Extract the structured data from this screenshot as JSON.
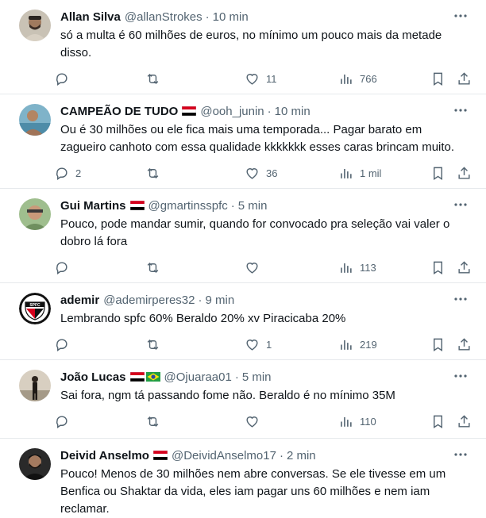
{
  "tweets": [
    {
      "name": "Allan Silva",
      "flags": [],
      "handle": "@allanStrokes",
      "time": "10 min",
      "text": "só a multa é 60 milhões de euros, no mínimo um pouco mais da metade\ndisso.",
      "replies": "",
      "retweets": "",
      "likes": "11",
      "views": "766"
    },
    {
      "name": "CAMPEÃO DE TUDO",
      "flags": [
        "spfc"
      ],
      "handle": "@ooh_junin",
      "time": "10 min",
      "text": "Ou é 30 milhões ou ele fica mais uma temporada... Pagar barato em\nzagueiro canhoto com essa qualidade kkkkkkk esses caras brincam muito.",
      "replies": "2",
      "retweets": "",
      "likes": "36",
      "views": "1 mil"
    },
    {
      "name": "Gui Martins",
      "flags": [
        "spfc"
      ],
      "handle": "@gmartinsspfc",
      "time": "5 min",
      "text": "Pouco, pode mandar sumir, quando for convocado pra seleção vai valer o\ndobro lá fora",
      "replies": "",
      "retweets": "",
      "likes": "",
      "views": "113"
    },
    {
      "name": "ademir",
      "flags": [],
      "handle": "@ademirperes32",
      "time": "9 min",
      "text": "Lembrando spfc 60% Beraldo 20% xv Piracicaba 20%",
      "replies": "",
      "retweets": "",
      "likes": "1",
      "views": "219"
    },
    {
      "name": "João Lucas",
      "flags": [
        "spfc",
        "brazil"
      ],
      "handle": "@Ojuaraa01",
      "time": "5 min",
      "text": "Sai fora, ngm tá passando fome não. Beraldo é no mínimo 35M",
      "replies": "",
      "retweets": "",
      "likes": "",
      "views": "110"
    },
    {
      "name": "Deivid Anselmo",
      "flags": [
        "spfc"
      ],
      "handle": "@DeividAnselmo17",
      "time": "2 min",
      "text": "Pouco! Menos de 30 milhões nem abre conversas. Se ele tivesse em um\nBenfica ou Shaktar da vida, eles iam pagar uns 60 milhões e nem iam\nreclamar.",
      "replies": "",
      "retweets": "",
      "likes": "",
      "views": ""
    }
  ],
  "avatars": {
    "ademir": "SPFC"
  },
  "colors": {
    "text": "#0f1419",
    "secondary": "#536471",
    "divider": "#e6e9ec"
  },
  "icons": [
    "more-icon",
    "reply-icon",
    "retweet-icon",
    "like-icon",
    "views-icon",
    "bookmark-icon",
    "share-icon"
  ]
}
